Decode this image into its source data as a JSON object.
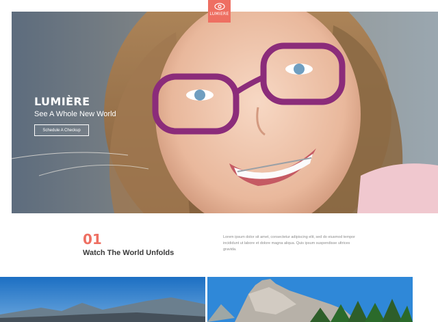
{
  "brand": {
    "logo_text": "LUMIERE",
    "logo_icon": "eye-icon",
    "accent_color": "#ee6f62"
  },
  "hero": {
    "title": "LUMIÈRE",
    "subtitle": "See A Whole New World",
    "cta_label": "Schedule A Checkup",
    "image": "smiling-girl-with-purple-glasses-and-braces"
  },
  "feature": {
    "number": "01",
    "title": "Watch The World Unfolds",
    "body": "Lorem ipsum dolor sit amet, consectetur adipiscing elit, sed do eiusmod tempor incididunt ut labore et dolore magna aliqua. Quis ipsum suspendisse ultrices gravida."
  },
  "gallery": {
    "left_image": "mountain-landscape",
    "right_image": "rocky-peak-with-pine-trees"
  }
}
